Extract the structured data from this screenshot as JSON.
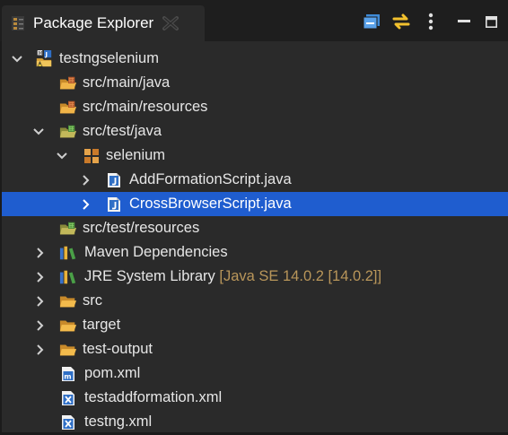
{
  "view": {
    "title": "Package Explorer",
    "icons": {
      "view": "package-explorer-icon",
      "close": "close-icon",
      "collapse": "collapse-all-icon",
      "link": "link-with-editor-icon",
      "menu": "view-menu-icon",
      "minimize": "minimize-icon",
      "maximize": "maximize-icon"
    }
  },
  "tree": [
    {
      "label": "testngselenium",
      "expanded": true,
      "icon": "project-icon"
    },
    {
      "label": "src/main/java",
      "icon": "source-folder-icon"
    },
    {
      "label": "src/main/resources",
      "icon": "source-folder-icon"
    },
    {
      "label": "src/test/java",
      "expanded": true,
      "icon": "test-source-folder-icon"
    },
    {
      "label": "selenium",
      "expanded": true,
      "icon": "package-icon"
    },
    {
      "label": "AddFormationScript.java",
      "expanded": false,
      "icon": "java-file-icon"
    },
    {
      "label": "CrossBrowserScript.java",
      "expanded": false,
      "icon": "java-file-icon",
      "selected": true
    },
    {
      "label": "src/test/resources",
      "icon": "test-source-folder-icon"
    },
    {
      "label": "Maven Dependencies",
      "expanded": false,
      "icon": "library-icon"
    },
    {
      "label": "JRE System Library",
      "decoration": "[Java SE 14.0.2 [14.0.2]]",
      "expanded": false,
      "icon": "library-icon"
    },
    {
      "label": "src",
      "expanded": false,
      "icon": "folder-icon"
    },
    {
      "label": "target",
      "expanded": false,
      "icon": "folder-icon"
    },
    {
      "label": "test-output",
      "expanded": false,
      "icon": "folder-icon"
    },
    {
      "label": "pom.xml",
      "icon": "maven-pom-icon"
    },
    {
      "label": "testaddformation.xml",
      "icon": "xml-file-icon"
    },
    {
      "label": "testng.xml",
      "icon": "xml-file-icon"
    }
  ],
  "colors": {
    "selection": "#1f5dcf",
    "background": "#2a2a2a",
    "decoration_text": "#b9965a"
  }
}
